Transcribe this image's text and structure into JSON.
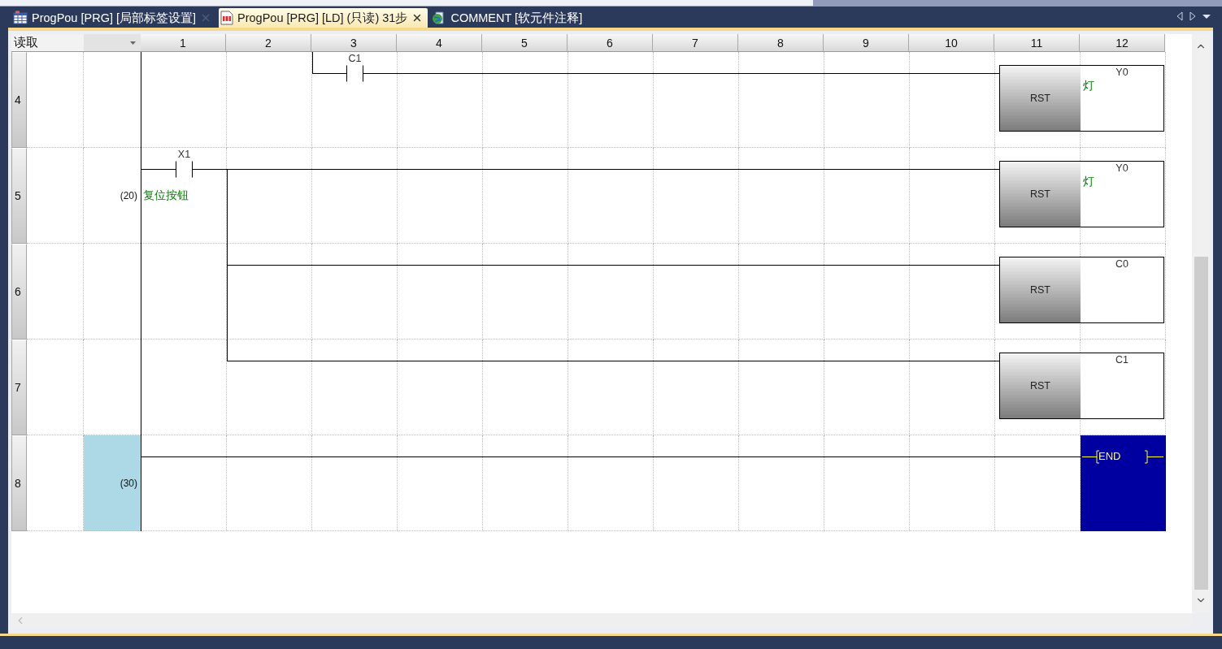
{
  "tabs": [
    {
      "kind": "table",
      "label": "ProgPou [PRG] [局部标签设置]",
      "selected": false,
      "closable": true
    },
    {
      "kind": "ladder",
      "label": "ProgPou [PRG] [LD] (只读) 31步",
      "selected": true,
      "closable": true
    },
    {
      "kind": "comment",
      "label": "COMMENT [软元件注释]",
      "selected": false,
      "closable": false
    }
  ],
  "header": {
    "mode": "读取",
    "columns": [
      "1",
      "2",
      "3",
      "4",
      "5",
      "6",
      "7",
      "8",
      "9",
      "10",
      "11",
      "12"
    ]
  },
  "rows": [
    {
      "number": "4",
      "step": "",
      "selected": false,
      "contact": {
        "label": "C1"
      },
      "cells": [
        {
          "kind": "blank"
        },
        {
          "kind": "blank"
        },
        {
          "kind": "contact_up"
        },
        {
          "kind": "wire"
        },
        {
          "kind": "wire"
        },
        {
          "kind": "wire"
        },
        {
          "kind": "wire"
        },
        {
          "kind": "wire"
        },
        {
          "kind": "wire"
        },
        {
          "kind": "wire"
        }
      ],
      "output": {
        "kind": "rst",
        "name": "RST",
        "operand": "Y0",
        "comment": "灯"
      }
    },
    {
      "number": "5",
      "step": "(20)",
      "selected": false,
      "contact": {
        "label": "X1",
        "comment": "复位按钮"
      },
      "cells": [
        {
          "kind": "contact"
        },
        {
          "kind": "wire_down"
        },
        {
          "kind": "wire"
        },
        {
          "kind": "wire"
        },
        {
          "kind": "wire"
        },
        {
          "kind": "wire"
        },
        {
          "kind": "wire"
        },
        {
          "kind": "wire"
        },
        {
          "kind": "wire"
        },
        {
          "kind": "wire"
        }
      ],
      "output": {
        "kind": "rst",
        "name": "RST",
        "operand": "Y0",
        "comment": "灯"
      }
    },
    {
      "number": "6",
      "step": "",
      "selected": false,
      "cells": [
        {
          "kind": "blank"
        },
        {
          "kind": "wire_through"
        },
        {
          "kind": "wire"
        },
        {
          "kind": "wire"
        },
        {
          "kind": "wire"
        },
        {
          "kind": "wire"
        },
        {
          "kind": "wire"
        },
        {
          "kind": "wire"
        },
        {
          "kind": "wire"
        },
        {
          "kind": "wire"
        }
      ],
      "output": {
        "kind": "rst",
        "name": "RST",
        "operand": "C0"
      }
    },
    {
      "number": "7",
      "step": "",
      "selected": false,
      "cells": [
        {
          "kind": "blank"
        },
        {
          "kind": "wire_up"
        },
        {
          "kind": "wire"
        },
        {
          "kind": "wire"
        },
        {
          "kind": "wire"
        },
        {
          "kind": "wire"
        },
        {
          "kind": "wire"
        },
        {
          "kind": "wire"
        },
        {
          "kind": "wire"
        },
        {
          "kind": "wire"
        }
      ],
      "output": {
        "kind": "rst",
        "name": "RST",
        "operand": "C1"
      }
    },
    {
      "number": "8",
      "step": "(30)",
      "selected": true,
      "cells": [
        {
          "kind": "wire"
        },
        {
          "kind": "wire"
        },
        {
          "kind": "wire"
        },
        {
          "kind": "wire"
        },
        {
          "kind": "wire"
        },
        {
          "kind": "wire"
        },
        {
          "kind": "wire"
        },
        {
          "kind": "wire"
        },
        {
          "kind": "wire"
        },
        {
          "kind": "wire"
        },
        {
          "kind": "wire"
        }
      ],
      "output": {
        "kind": "end",
        "name": "END"
      }
    }
  ]
}
